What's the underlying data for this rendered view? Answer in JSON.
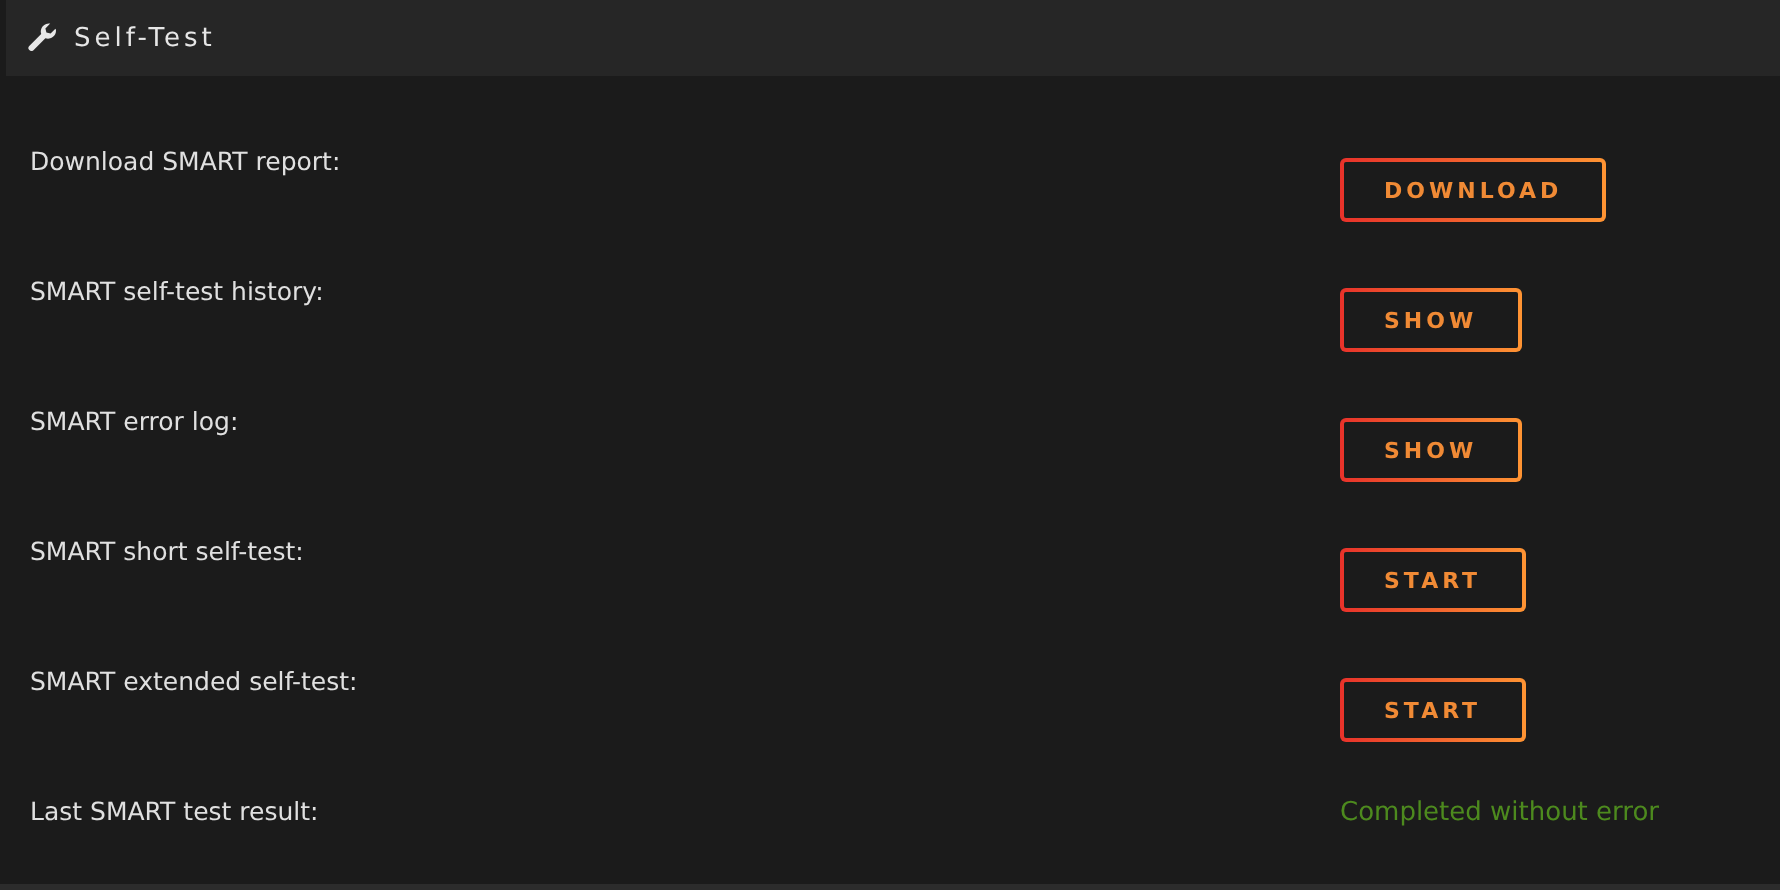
{
  "header": {
    "title": "Self-Test"
  },
  "rows": [
    {
      "label": "Download SMART report:",
      "kind": "button",
      "value": "DOWNLOAD"
    },
    {
      "label": "SMART self-test history:",
      "kind": "button",
      "value": "SHOW"
    },
    {
      "label": "SMART error log:",
      "kind": "button",
      "value": "SHOW"
    },
    {
      "label": "SMART short self-test:",
      "kind": "button",
      "value": "START"
    },
    {
      "label": "SMART extended self-test:",
      "kind": "button",
      "value": "START"
    },
    {
      "label": "Last SMART test result:",
      "kind": "result",
      "value": "Completed without error"
    }
  ]
}
